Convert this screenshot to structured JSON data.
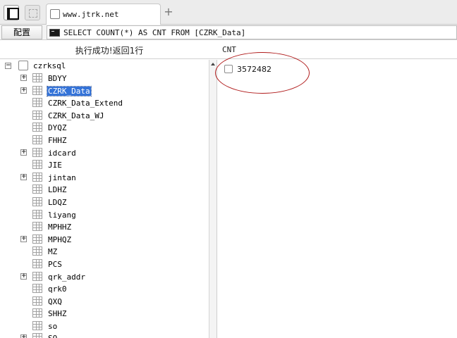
{
  "tab": {
    "title": "www.jtrk.net",
    "new_tab": "+"
  },
  "toolbar": {
    "config_label": "配置",
    "sql": "SELECT COUNT(*) AS CNT FROM [CZRK_Data]"
  },
  "status": {
    "message": "执行成功!返回1行"
  },
  "result": {
    "column": "CNT",
    "value": "3572482"
  },
  "tree": {
    "root": {
      "label": "czrksql",
      "expander": "−"
    },
    "items": [
      {
        "label": "BDYY",
        "expander": "+"
      },
      {
        "label": "CZRK_Data",
        "expander": "+",
        "selected": true
      },
      {
        "label": "CZRK_Data_Extend"
      },
      {
        "label": "CZRK_Data_WJ"
      },
      {
        "label": "DYQZ"
      },
      {
        "label": "FHHZ"
      },
      {
        "label": "idcard",
        "expander": "+"
      },
      {
        "label": "JIE"
      },
      {
        "label": "jintan",
        "expander": "+"
      },
      {
        "label": "LDHZ"
      },
      {
        "label": "LDQZ"
      },
      {
        "label": "liyang"
      },
      {
        "label": "MPHHZ"
      },
      {
        "label": "MPHQZ",
        "expander": "+"
      },
      {
        "label": "MZ"
      },
      {
        "label": "PCS"
      },
      {
        "label": "qrk_addr",
        "expander": "+"
      },
      {
        "label": "qrk0"
      },
      {
        "label": "QXQ"
      },
      {
        "label": "SHHZ"
      },
      {
        "label": "so"
      },
      {
        "label": "SQ",
        "expander": "+"
      }
    ]
  },
  "colors": {
    "selection": "#3473d8",
    "annotation": "#b01b1b",
    "chrome": "#ececec"
  }
}
